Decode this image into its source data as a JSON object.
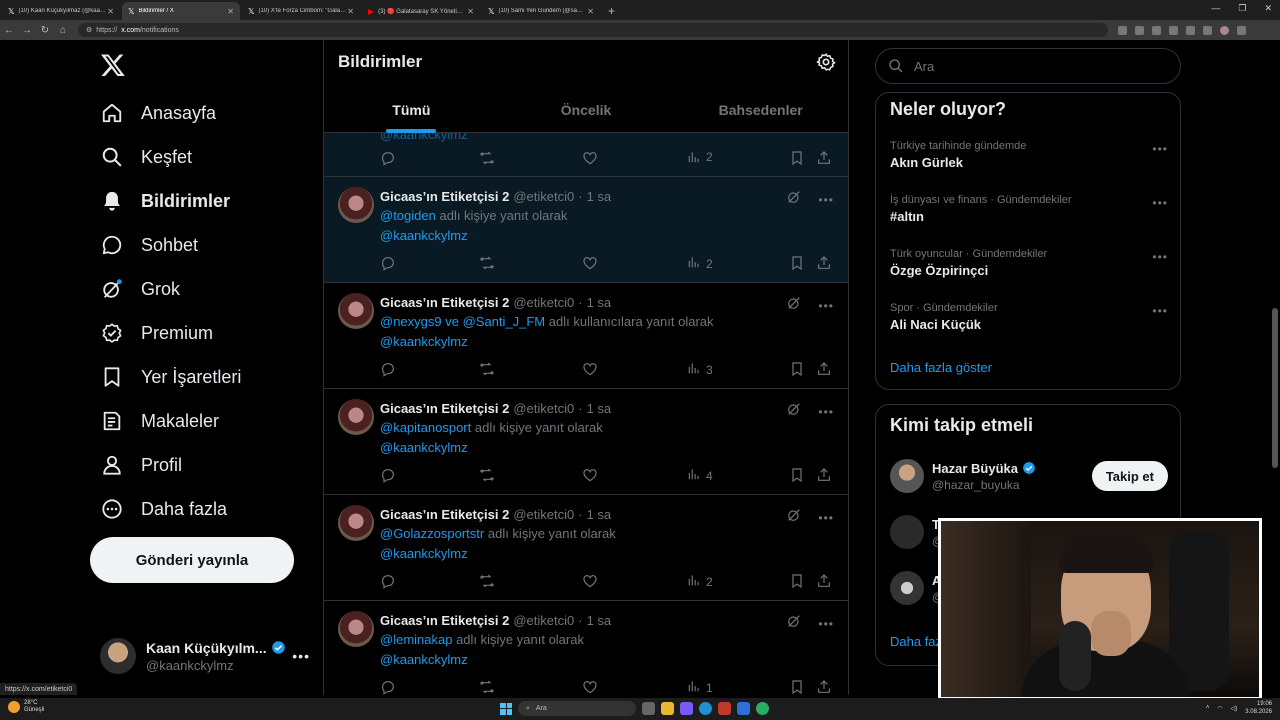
{
  "browser": {
    "tabs": [
      {
        "title": "(10) Kaan Küçükyılmaz (@kaanck",
        "active": false
      },
      {
        "title": "Bildirimler / X",
        "active": true
      },
      {
        "title": "(10) X'te Forza Cimbom: \"Galatas...",
        "active": false
      },
      {
        "title": "(3) 🔴 Galatasaray SK Yönetim Ku",
        "active": false
      },
      {
        "title": "(10) Sami Yen Gündem (@samiyen",
        "active": false
      }
    ],
    "url_prefix": "https://",
    "url_domain": "x.com",
    "url_path": "/notifications",
    "status_url": "https://x.com/etiketci0"
  },
  "sidebar": {
    "items": [
      {
        "label": "Anasayfa",
        "icon": "home-icon"
      },
      {
        "label": "Keşfet",
        "icon": "search-icon"
      },
      {
        "label": "Bildirimler",
        "icon": "bell-icon"
      },
      {
        "label": "Sohbet",
        "icon": "chat-icon"
      },
      {
        "label": "Grok",
        "icon": "grok-icon"
      },
      {
        "label": "Premium",
        "icon": "premium-icon"
      },
      {
        "label": "Yer İşaretleri",
        "icon": "bookmark-icon"
      },
      {
        "label": "Makaleler",
        "icon": "article-icon"
      },
      {
        "label": "Profil",
        "icon": "profile-icon"
      },
      {
        "label": "Daha fazla",
        "icon": "more-circle-icon"
      }
    ],
    "post_button": "Gönderi yayınla",
    "account": {
      "name": "Kaan Küçükyılm...",
      "handle": "@kaankckylmz"
    }
  },
  "main": {
    "title": "Bildirimler",
    "tabs": [
      "Tümü",
      "Öncelik",
      "Bahsedenler"
    ],
    "partial": {
      "mention": "@kaankckylmz",
      "views": "2"
    },
    "notifications": [
      {
        "name": "Gicaas’ın Etiketçisi 2",
        "handle": "@etiketci0",
        "sep": "·",
        "time": "1 sa",
        "to": "@togiden",
        "suffix": "adlı kişiye yanıt olarak",
        "mention": "@kaankckylmz",
        "views": "2"
      },
      {
        "name": "Gicaas’ın Etiketçisi 2",
        "handle": "@etiketci0",
        "sep": "·",
        "time": "1 sa",
        "to": "@nexygs9 ve @Santi_J_FM",
        "suffix": "adlı kullanıcılara yanıt olarak",
        "mention": "@kaankckylmz",
        "views": "3"
      },
      {
        "name": "Gicaas’ın Etiketçisi 2",
        "handle": "@etiketci0",
        "sep": "·",
        "time": "1 sa",
        "to": "@kapitanosport",
        "suffix": "adlı kişiye yanıt olarak",
        "mention": "@kaankckylmz",
        "views": "4"
      },
      {
        "name": "Gicaas’ın Etiketçisi 2",
        "handle": "@etiketci0",
        "sep": "·",
        "time": "1 sa",
        "to": "@Golazzosportstr",
        "suffix": "adlı kişiye yanıt olarak",
        "mention": "@kaankckylmz",
        "views": "2"
      },
      {
        "name": "Gicaas’ın Etiketçisi 2",
        "handle": "@etiketci0",
        "sep": "·",
        "time": "1 sa",
        "to": "@leminakap",
        "suffix": "adlı kişiye yanıt olarak",
        "mention": "@kaankckylmz",
        "views": "1"
      }
    ]
  },
  "right": {
    "search_placeholder": "Ara",
    "trends_title": "Neler oluyor?",
    "trends": [
      {
        "context": "Türkiye tarihinde gündemde",
        "title": "Akın Gürlek"
      },
      {
        "context": "İş dünyası ve finans · Gündemdekiler",
        "title": "#altın"
      },
      {
        "context": "Türk oyuncular · Gündemdekiler",
        "title": "Özge Özpirinçci"
      },
      {
        "context": "Spor · Gündemdekiler",
        "title": "Ali Naci Küçük"
      }
    ],
    "trends_more": "Daha fazla göster",
    "follow_title": "Kimi takip etmeli",
    "follow": [
      {
        "name": "Hazar Büyüka",
        "handle": "@hazar_buyuka",
        "button": "Takip et"
      },
      {
        "name": "T",
        "handle": "@"
      },
      {
        "name": "A",
        "handle": "@"
      }
    ],
    "follow_more": "Daha faz"
  },
  "taskbar": {
    "weather_temp": "28°C",
    "weather_text": "Güneşli",
    "search": "Ara",
    "time": "19:06",
    "date": "3.08.2026"
  },
  "colors": {
    "accent": "#1d9bf0",
    "background": "#000000",
    "muted": "#71767b",
    "border": "#2f3336"
  }
}
